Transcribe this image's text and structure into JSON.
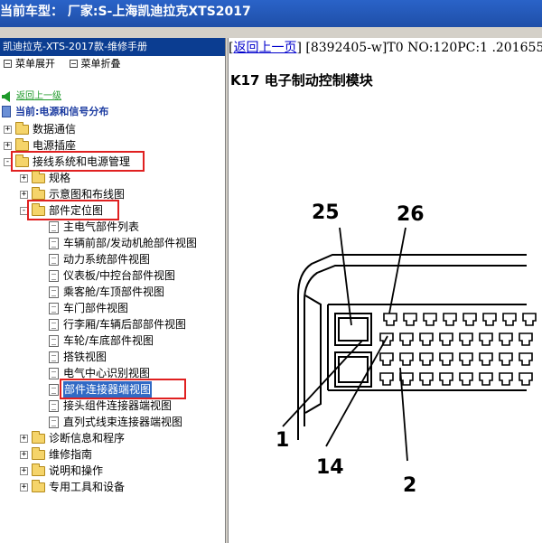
{
  "window": {
    "title": "当前车型：  厂家:S-上海凯迪拉克XTS2017"
  },
  "manual": {
    "title": "凯迪拉克-XTS-2017款-维修手册",
    "expand_all": "菜单展开",
    "collapse_all": "菜单折叠"
  },
  "nav": {
    "back_link": "返回上一级",
    "current": "当前:电源和信号分布"
  },
  "tree": [
    {
      "label": "数据通信",
      "type": "folder",
      "state": "+",
      "level": 0
    },
    {
      "label": "电源插座",
      "type": "folder",
      "state": "+",
      "level": 0
    },
    {
      "label": "接线系统和电源管理",
      "type": "folder",
      "state": "-",
      "level": 0,
      "highlight": true
    },
    {
      "label": "规格",
      "type": "folder",
      "state": "+",
      "level": 1
    },
    {
      "label": "示意图和布线图",
      "type": "folder",
      "state": "+",
      "level": 1
    },
    {
      "label": "部件定位图",
      "type": "folder",
      "state": "-",
      "level": 1,
      "highlight": true
    },
    {
      "label": "主电气部件列表",
      "type": "doc",
      "level": 2
    },
    {
      "label": "车辆前部/发动机舱部件视图",
      "type": "doc",
      "level": 2
    },
    {
      "label": "动力系统部件视图",
      "type": "doc",
      "level": 2
    },
    {
      "label": "仪表板/中控台部件视图",
      "type": "doc",
      "level": 2
    },
    {
      "label": "乘客舱/车顶部件视图",
      "type": "doc",
      "level": 2
    },
    {
      "label": "车门部件视图",
      "type": "doc",
      "level": 2
    },
    {
      "label": "行李厢/车辆后部部件视图",
      "type": "doc",
      "level": 2
    },
    {
      "label": "车轮/车底部件视图",
      "type": "doc",
      "level": 2
    },
    {
      "label": "搭铁视图",
      "type": "doc",
      "level": 2
    },
    {
      "label": "电气中心识别视图",
      "type": "doc",
      "level": 2
    },
    {
      "label": "部件连接器端视图",
      "type": "doc",
      "level": 2,
      "highlight": true,
      "selected": true
    },
    {
      "label": "接头组件连接器端视图",
      "type": "doc",
      "level": 2
    },
    {
      "label": "直列式线束连接器端视图",
      "type": "doc",
      "level": 2
    },
    {
      "label": "诊断信息和程序",
      "type": "folder",
      "state": "+",
      "level": 1
    },
    {
      "label": "维修指南",
      "type": "folder",
      "state": "+",
      "level": 1
    },
    {
      "label": "说明和操作",
      "type": "folder",
      "state": "+",
      "level": 1
    },
    {
      "label": "专用工具和设备",
      "type": "folder",
      "state": "+",
      "level": 1
    }
  ],
  "content": {
    "back_page": "返回上一页",
    "doc_ref": " [8392405-w]T0 NO:120PC:1 .201655",
    "heading": "K17 电子制动控制模块",
    "callouts": [
      "25",
      "26",
      "1",
      "14",
      "2"
    ]
  },
  "colors": {
    "highlight_box": "#e02020",
    "selection": "#316ac5",
    "title_bar": "#1f4fa8"
  }
}
